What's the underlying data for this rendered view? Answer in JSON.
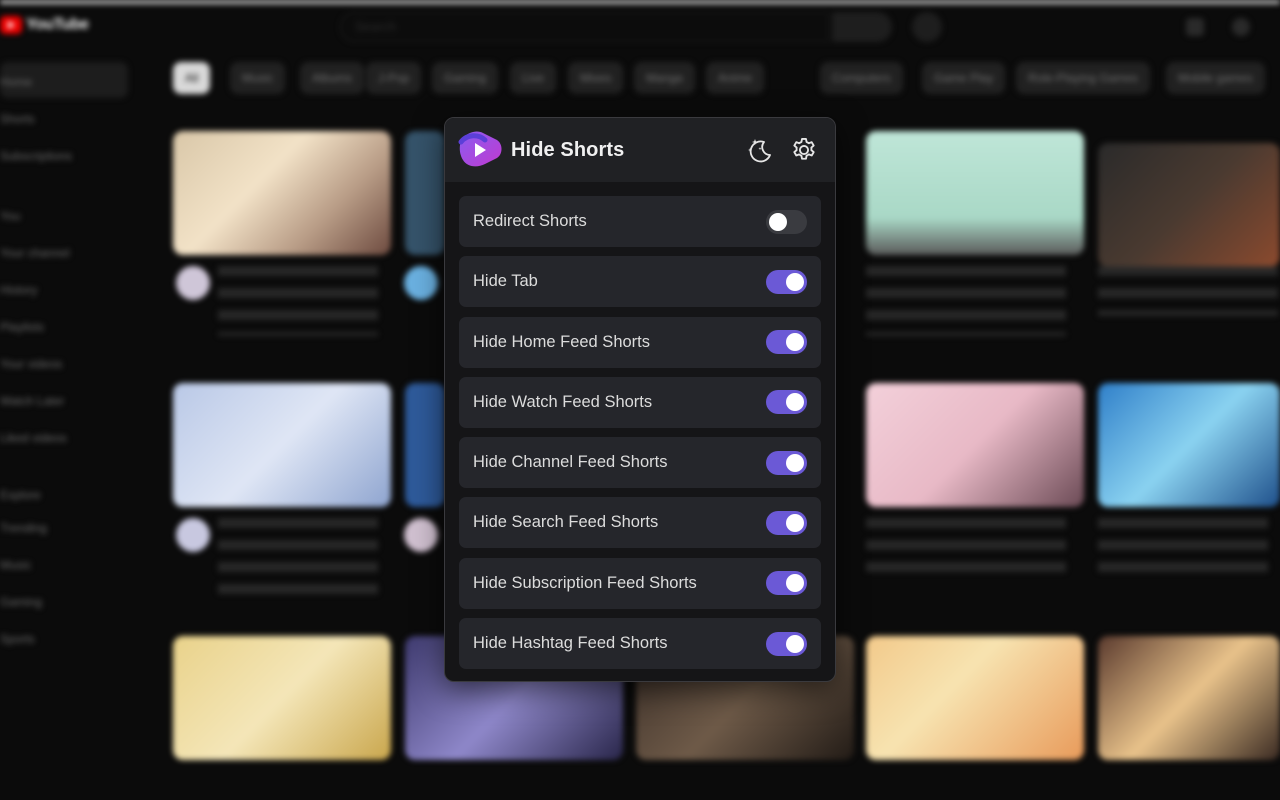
{
  "background": {
    "logo_text": "YouTube",
    "search_placeholder": "Search",
    "sidebar": [
      "Home",
      "Shorts",
      "Subscriptions",
      "You",
      "Your channel",
      "History",
      "Playlists",
      "Your videos",
      "Watch Later",
      "Liked videos",
      "Explore",
      "Trending",
      "Music",
      "Gaming",
      "Sports"
    ],
    "chips": [
      "All",
      "Music",
      "Albums",
      "J-Pop",
      "Gaming",
      "Live",
      "Mixes",
      "Manga",
      "Anime",
      "Computers",
      "Game Play",
      "Role-Playing Games",
      "Mobile games"
    ]
  },
  "popup": {
    "title": "Hide Shorts",
    "icons": {
      "theme": "moon-stars-icon",
      "settings": "gear-icon"
    },
    "accent_color": "#6b59d6",
    "settings": [
      {
        "label": "Redirect Shorts",
        "enabled": false
      },
      {
        "label": "Hide Tab",
        "enabled": true
      },
      {
        "label": "Hide Home Feed Shorts",
        "enabled": true
      },
      {
        "label": "Hide Watch Feed Shorts",
        "enabled": true
      },
      {
        "label": "Hide Channel Feed Shorts",
        "enabled": true
      },
      {
        "label": "Hide Search Feed Shorts",
        "enabled": true
      },
      {
        "label": "Hide Subscription Feed Shorts",
        "enabled": true
      },
      {
        "label": "Hide Hashtag Feed Shorts",
        "enabled": true
      }
    ]
  }
}
